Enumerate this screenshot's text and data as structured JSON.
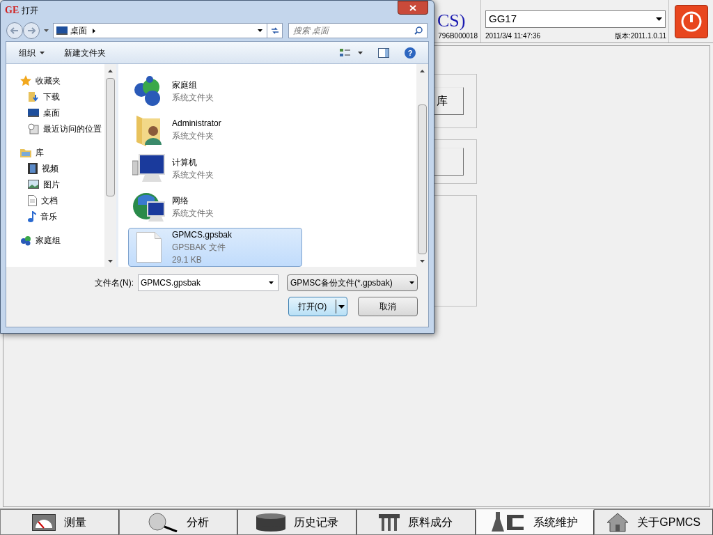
{
  "app": {
    "title_fragment": "CS)",
    "serial_fragment": "796B000018",
    "device_select": {
      "value": "GG17"
    },
    "datetime": "2011/3/4 11:47:36",
    "version": "版本:2011.1.0.11",
    "panel_buttons": [
      "库"
    ],
    "bottom_tabs": [
      {
        "label": "测量",
        "selected": false
      },
      {
        "label": "分析",
        "selected": false
      },
      {
        "label": "历史记录",
        "selected": false
      },
      {
        "label": "原料成分",
        "selected": false
      },
      {
        "label": "系统维护",
        "selected": true
      },
      {
        "label": "关于GPMCS",
        "selected": false
      }
    ]
  },
  "dialog": {
    "icon_text": "GE",
    "title": "打开",
    "breadcrumb": "桌面",
    "search": {
      "placeholder": "搜索 桌面"
    },
    "toolbar": [
      "组织",
      "新建文件夹"
    ],
    "help_icon_text": "?",
    "nav": [
      {
        "label": "收藏夹",
        "children": [
          {
            "label": "下载"
          },
          {
            "label": "桌面"
          },
          {
            "label": "最近访问的位置"
          }
        ]
      },
      {
        "label": "库",
        "children": [
          {
            "label": "视频"
          },
          {
            "label": "图片"
          },
          {
            "label": "文档"
          },
          {
            "label": "音乐"
          }
        ]
      },
      {
        "label": "家庭组"
      }
    ],
    "files": [
      {
        "name": "家庭组",
        "type": "系统文件夹",
        "selected": false
      },
      {
        "name": "Administrator",
        "type": "系统文件夹",
        "selected": false
      },
      {
        "name": "计算机",
        "type": "系统文件夹",
        "selected": false
      },
      {
        "name": "网络",
        "type": "系统文件夹",
        "selected": false
      },
      {
        "name": "GPMCS.gpsbak",
        "type": "GPSBAK 文件",
        "size": "29.1 KB",
        "selected": true
      }
    ],
    "filename_label": "文件名(N):",
    "filename": {
      "value": "GPMCS.gpsbak"
    },
    "filetype": "GPMSC备份文件(*.gpsbak)",
    "buttons": [
      "打开(O)",
      "取消"
    ]
  }
}
